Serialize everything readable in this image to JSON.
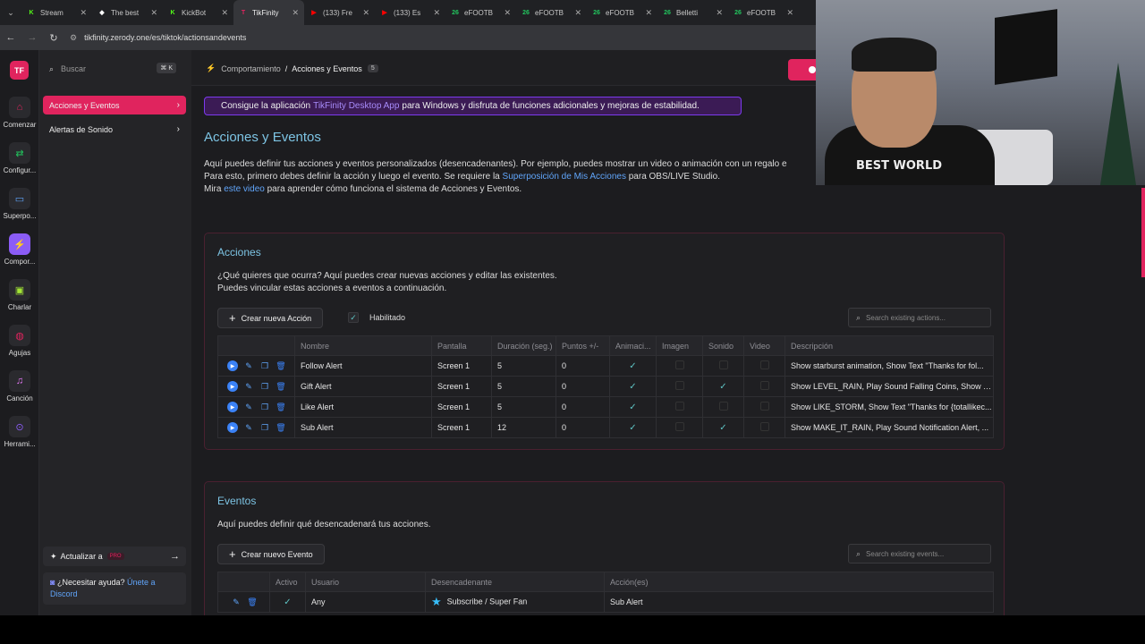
{
  "browser": {
    "tabs": [
      {
        "title": "Stream",
        "favicon": "K",
        "fav_color": "#53fc18",
        "active": false
      },
      {
        "title": "The best",
        "favicon": "◆",
        "fav_color": "#ffffff",
        "active": false
      },
      {
        "title": "KickBot",
        "favicon": "K",
        "fav_color": "#53fc18",
        "active": false
      },
      {
        "title": "TikFinity",
        "favicon": "T",
        "fav_color": "#e0245e",
        "active": true
      },
      {
        "title": "(133) Fre",
        "favicon": "▶",
        "fav_color": "#ff0000",
        "active": false
      },
      {
        "title": "(133) Es",
        "favicon": "▶",
        "fav_color": "#ff0000",
        "active": false
      },
      {
        "title": "eFOOTB",
        "favicon": "26",
        "fav_color": "#22c55e",
        "active": false
      },
      {
        "title": "eFOOTB",
        "favicon": "26",
        "fav_color": "#22c55e",
        "active": false
      },
      {
        "title": "eFOOTB",
        "favicon": "26",
        "fav_color": "#22c55e",
        "active": false
      },
      {
        "title": "Belletti",
        "favicon": "26",
        "fav_color": "#22c55e",
        "active": false
      },
      {
        "title": "eFOOTB",
        "favicon": "26",
        "fav_color": "#22c55e",
        "active": false
      }
    ],
    "url": "tikfinity.zerody.one/es/tiktok/actionsandevents"
  },
  "rail": {
    "logo": "TF",
    "items": [
      {
        "label": "Comenzar",
        "icon": "⌂",
        "icon_name": "home-icon",
        "active": false
      },
      {
        "label": "Configur...",
        "icon": "⇄",
        "icon_name": "settings-icon",
        "active": false
      },
      {
        "label": "Superpo...",
        "icon": "▭",
        "icon_name": "monitor-icon",
        "active": false
      },
      {
        "label": "Compor...",
        "icon": "⚡",
        "icon_name": "bolt-icon",
        "active": true
      },
      {
        "label": "Charlar",
        "icon": "▣",
        "icon_name": "chat-icon",
        "active": false
      },
      {
        "label": "Agujas",
        "icon": "◍",
        "icon_name": "goals-icon",
        "active": false
      },
      {
        "label": "Canción",
        "icon": "♫",
        "icon_name": "song-icon",
        "active": false
      },
      {
        "label": "Herrami...",
        "icon": "⊙",
        "icon_name": "tools-icon",
        "active": false
      }
    ]
  },
  "sidebar": {
    "search_placeholder": "Buscar",
    "search_kbd": "⌘ K",
    "items": [
      {
        "label": "Acciones y Eventos",
        "active": true
      },
      {
        "label": "Alertas de Sonido",
        "active": false
      }
    ],
    "upgrade_label": "Actualizar a",
    "upgrade_badge": "PRO",
    "help_label": "¿Necesitar ayuda?",
    "help_link_1": "Únete a",
    "help_link_2": "Discord"
  },
  "header": {
    "crumb_parent": "Comportamiento",
    "crumb_sep": "/",
    "crumb_current": "Acciones y Eventos",
    "crumb_count": "5"
  },
  "promo": {
    "pre": "Consigue la aplicación",
    "link": "TikFinity Desktop App",
    "post": "para Windows y disfruta de funciones adicionales y mejoras de estabilidad."
  },
  "page": {
    "title": "Acciones y Eventos",
    "intro_1": "Aquí puedes definir tus acciones y eventos personalizados (desencadenantes). Por ejemplo, puedes mostrar un video o animación con un regalo e",
    "intro_2_pre": "Para esto, primero debes definir la acción y luego el evento. Se requiere la",
    "intro_2_link": "Superposición de Mis Acciones",
    "intro_2_post": "para OBS/LIVE Studio.",
    "intro_3_pre": "Mira",
    "intro_3_link": "este video",
    "intro_3_post": "para aprender cómo funciona el sistema de Acciones y Eventos."
  },
  "actions": {
    "title": "Acciones",
    "desc_1": "¿Qué quieres que ocurra? Aquí puedes crear nuevas acciones y editar las existentes.",
    "desc_2": "Puedes vincular estas acciones a eventos a continuación.",
    "create_label": "Crear nueva Acción",
    "enabled_label": "Habilitado",
    "search_placeholder": "Search existing actions...",
    "columns": [
      "Nombre",
      "Pantalla",
      "Duración (seg.)",
      "Puntos +/-",
      "Animaci...",
      "Imagen",
      "Sonido",
      "Video",
      "Descripción"
    ],
    "rows": [
      {
        "name": "Follow Alert",
        "screen": "Screen 1",
        "duration": "5",
        "points": "0",
        "anim": true,
        "image": false,
        "sound": false,
        "video": false,
        "desc": "Show starburst animation, Show Text \"Thanks for fol..."
      },
      {
        "name": "Gift Alert",
        "screen": "Screen 1",
        "duration": "5",
        "points": "0",
        "anim": true,
        "image": false,
        "sound": true,
        "video": false,
        "desc": "Show LEVEL_RAIN, Play Sound Falling Coins, Show T..."
      },
      {
        "name": "Like Alert",
        "screen": "Screen 1",
        "duration": "5",
        "points": "0",
        "anim": true,
        "image": false,
        "sound": false,
        "video": false,
        "desc": "Show LIKE_STORM, Show Text \"Thanks for {totallikec..."
      },
      {
        "name": "Sub Alert",
        "screen": "Screen 1",
        "duration": "12",
        "points": "0",
        "anim": true,
        "image": false,
        "sound": true,
        "video": false,
        "desc": "Show MAKE_IT_RAIN, Play Sound Notification Alert, ..."
      }
    ]
  },
  "events": {
    "title": "Eventos",
    "desc": "Aquí puedes definir qué desencadenará tus acciones.",
    "create_label": "Crear nuevo Evento",
    "search_placeholder": "Search existing events...",
    "columns": [
      "Activo",
      "Usuario",
      "Desencadenante",
      "Acción(es)"
    ],
    "rows": [
      {
        "active": true,
        "user": "Any",
        "trigger": "Subscribe / Super Fan",
        "actions": "Sub Alert"
      }
    ]
  },
  "webcam": {
    "shirt_text": "BEST WORLD"
  },
  "colors": {
    "accent": "#e0245e",
    "link": "#60a5fa",
    "heading": "#7dc4e4",
    "promo_bg": "#3b1b55"
  }
}
